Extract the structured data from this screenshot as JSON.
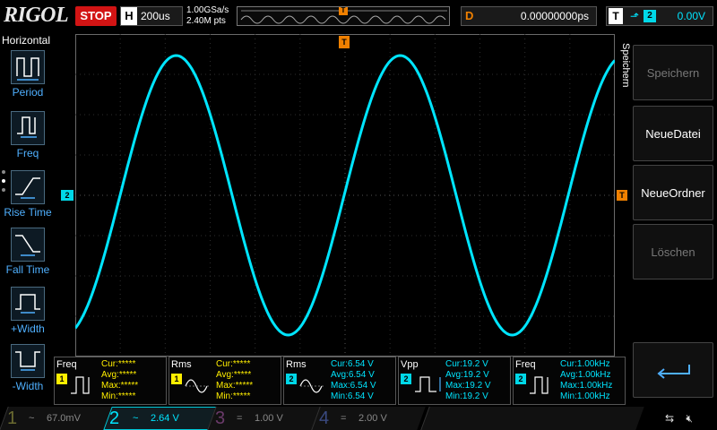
{
  "header": {
    "logo": "RIGOL",
    "run_state": "STOP",
    "horizontal": {
      "label": "H",
      "timebase": "200us"
    },
    "sample_rate": "1.00GSa/s",
    "memory_depth": "2.40M pts",
    "trigger_position_marker": "T",
    "delay": {
      "label": "D",
      "value": "0.00000000ps"
    },
    "trigger": {
      "label": "T",
      "edge": "rising-edge-icon",
      "source": "2",
      "level": "0.00V"
    }
  },
  "left_menu": {
    "title": "Horizontal",
    "items": [
      {
        "label": "Period",
        "icon": "period-icon"
      },
      {
        "label": "Freq",
        "icon": "freq-icon"
      },
      {
        "label": "Rise Time",
        "icon": "rise-time-icon"
      },
      {
        "label": "Fall Time",
        "icon": "fall-time-icon"
      },
      {
        "label": "+Width",
        "icon": "pos-width-icon"
      },
      {
        "label": "-Width",
        "icon": "neg-width-icon"
      }
    ]
  },
  "right_menu": {
    "title": "Speichern",
    "buttons": [
      {
        "label": "Speichern",
        "enabled": false
      },
      {
        "label": "NeueDatei",
        "enabled": true
      },
      {
        "label": "NeueOrdner",
        "enabled": true
      },
      {
        "label": "Löschen",
        "enabled": false
      },
      {
        "label": "",
        "icon": "return-arrow-icon",
        "enabled": true
      }
    ]
  },
  "markers": {
    "ch2_ground": "2",
    "trigger_level": "T",
    "trigger_top": "T"
  },
  "measurements": [
    {
      "name": "Freq",
      "channel": "1",
      "cur": "Cur:*****",
      "avg": "Avg:*****",
      "max": "Max:*****",
      "min": "Min:*****"
    },
    {
      "name": "Rms",
      "channel": "1",
      "cur": "Cur:*****",
      "avg": "Avg:*****",
      "max": "Max:*****",
      "min": "Min:*****"
    },
    {
      "name": "Rms",
      "channel": "2",
      "cur": "Cur:6.54 V",
      "avg": "Avg:6.54 V",
      "max": "Max:6.54 V",
      "min": "Min:6.54 V"
    },
    {
      "name": "Vpp",
      "channel": "2",
      "cur": "Cur:19.2 V",
      "avg": "Avg:19.2 V",
      "max": "Max:19.2 V",
      "min": "Min:19.2 V"
    },
    {
      "name": "Freq",
      "channel": "2",
      "cur": "Cur:1.00kHz",
      "avg": "Avg:1.00kHz",
      "max": "Max:1.00kHz",
      "min": "Min:1.00kHz"
    }
  ],
  "channels": [
    {
      "num": "1",
      "coupling": "~",
      "scale": "67.0mV",
      "color": "#9a9a40",
      "active": false
    },
    {
      "num": "2",
      "coupling": "~",
      "scale": "2.64 V",
      "color": "#00e5ff",
      "active": true
    },
    {
      "num": "3",
      "coupling": "=",
      "scale": "1.00 V",
      "color": "#a050a0",
      "active": false
    },
    {
      "num": "4",
      "coupling": "=",
      "scale": "2.00 V",
      "color": "#5070c0",
      "active": false
    }
  ],
  "status": {
    "usb": "usb-icon",
    "speaker": "speaker-muted-icon"
  },
  "colors": {
    "trace": "#00e5ff",
    "grid": "#3a3a3a",
    "trigger": "#f08000",
    "stop": "#d21414"
  }
}
